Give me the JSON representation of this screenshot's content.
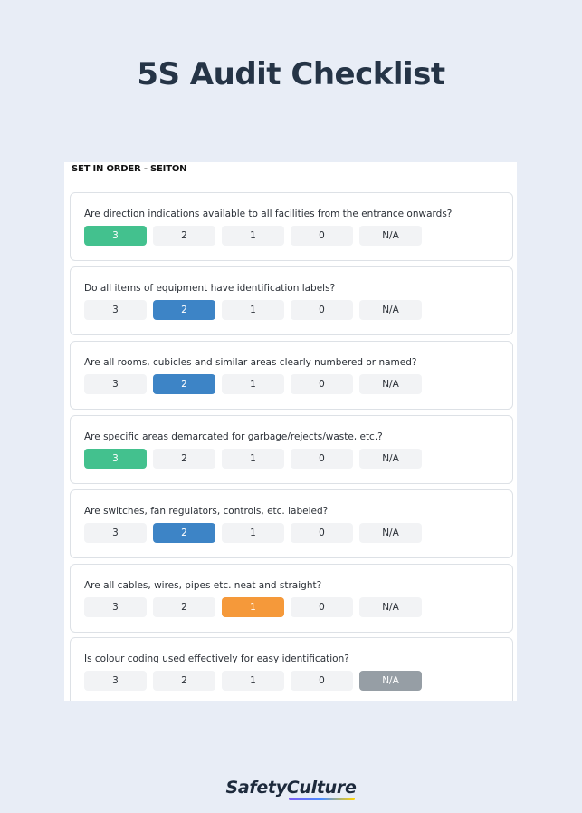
{
  "page": {
    "title": "5S Audit Checklist"
  },
  "section": {
    "header": "SET IN ORDER - SEITON"
  },
  "questions": [
    {
      "text": "Are direction indications available to all facilities from the entrance onwards?",
      "options": [
        "3",
        "2",
        "1",
        "0",
        "N/A"
      ],
      "selected": "3"
    },
    {
      "text": "Do all items of equipment have identification labels?",
      "options": [
        "3",
        "2",
        "1",
        "0",
        "N/A"
      ],
      "selected": "2"
    },
    {
      "text": "Are all rooms, cubicles and similar areas clearly numbered or named?",
      "options": [
        "3",
        "2",
        "1",
        "0",
        "N/A"
      ],
      "selected": "2"
    },
    {
      "text": "Are specific areas demarcated for garbage/rejects/waste, etc.?",
      "options": [
        "3",
        "2",
        "1",
        "0",
        "N/A"
      ],
      "selected": "3"
    },
    {
      "text": "Are switches, fan regulators, controls, etc. labeled?",
      "options": [
        "3",
        "2",
        "1",
        "0",
        "N/A"
      ],
      "selected": "2"
    },
    {
      "text": "Are all cables, wires, pipes etc. neat and straight?",
      "options": [
        "3",
        "2",
        "1",
        "0",
        "N/A"
      ],
      "selected": "1"
    },
    {
      "text": "Is colour coding used effectively for easy identification?",
      "options": [
        "3",
        "2",
        "1",
        "0",
        "N/A"
      ],
      "selected": "N/A"
    }
  ],
  "selection_colors": {
    "3": "#43c18e",
    "2": "#3d84c6",
    "1": "#f5993a",
    "N/A": "#969ea5"
  },
  "brand": {
    "name": "SafetyCulture",
    "logo_colors": [
      "#7c5cf2",
      "#4a8cff",
      "#ffd400"
    ]
  }
}
